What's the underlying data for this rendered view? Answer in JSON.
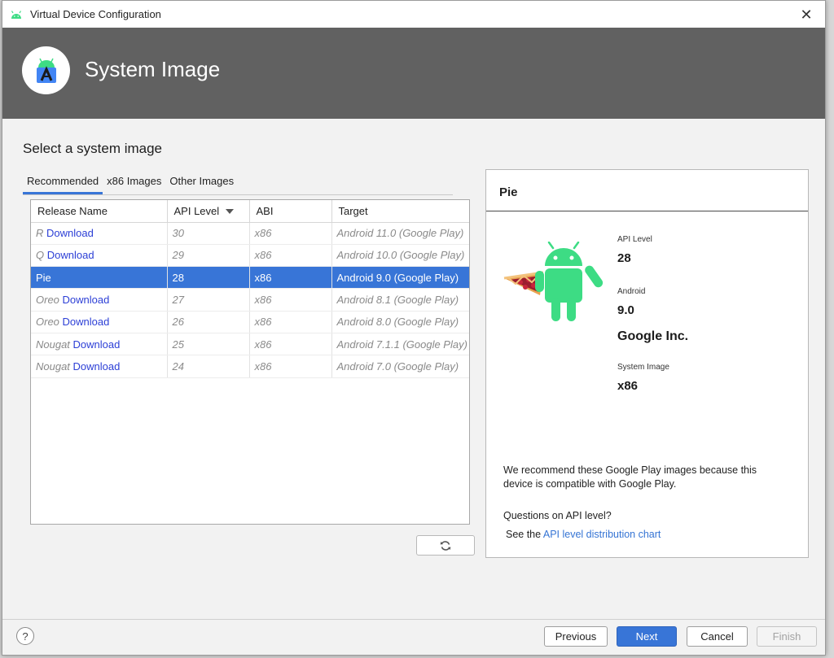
{
  "window": {
    "title": "Virtual Device Configuration",
    "close_glyph": "✕"
  },
  "header": {
    "title": "System Image"
  },
  "section_title": "Select a system image",
  "tabs": [
    {
      "label": "Recommended",
      "active": true
    },
    {
      "label": "x86 Images",
      "active": false
    },
    {
      "label": "Other Images",
      "active": false
    }
  ],
  "table": {
    "columns": [
      "Release Name",
      "API Level",
      "ABI",
      "Target"
    ],
    "rows": [
      {
        "release": "R",
        "download": "Download",
        "api": "30",
        "abi": "x86",
        "target": "Android 11.0 (Google Play)",
        "selected": false
      },
      {
        "release": "Q",
        "download": "Download",
        "api": "29",
        "abi": "x86",
        "target": "Android 10.0 (Google Play)",
        "selected": false
      },
      {
        "release": "Pie",
        "download": "",
        "api": "28",
        "abi": "x86",
        "target": "Android 9.0 (Google Play)",
        "selected": true
      },
      {
        "release": "Oreo",
        "download": "Download",
        "api": "27",
        "abi": "x86",
        "target": "Android 8.1 (Google Play)",
        "selected": false
      },
      {
        "release": "Oreo",
        "download": "Download",
        "api": "26",
        "abi": "x86",
        "target": "Android 8.0 (Google Play)",
        "selected": false
      },
      {
        "release": "Nougat",
        "download": "Download",
        "api": "25",
        "abi": "x86",
        "target": "Android 7.1.1 (Google Play)",
        "selected": false
      },
      {
        "release": "Nougat",
        "download": "Download",
        "api": "24",
        "abi": "x86",
        "target": "Android 7.0 (Google Play)",
        "selected": false
      }
    ]
  },
  "refresh_icon": "refresh-icon",
  "detail": {
    "title": "Pie",
    "api_level_label": "API Level",
    "api_level_value": "28",
    "android_label": "Android",
    "android_value": "9.0",
    "vendor": "Google Inc.",
    "system_image_label": "System Image",
    "system_image_value": "x86",
    "recommend_text": "We recommend these Google Play images because this device is compatible with Google Play.",
    "question": "Questions on API level?",
    "see_prefix": "See the ",
    "see_link": "API level distribution chart"
  },
  "footer": {
    "help": "?",
    "previous": "Previous",
    "next": "Next",
    "cancel": "Cancel",
    "finish": "Finish"
  },
  "colors": {
    "accent": "#3875d7",
    "header_bg": "#616161",
    "link": "#2c3fd6"
  }
}
